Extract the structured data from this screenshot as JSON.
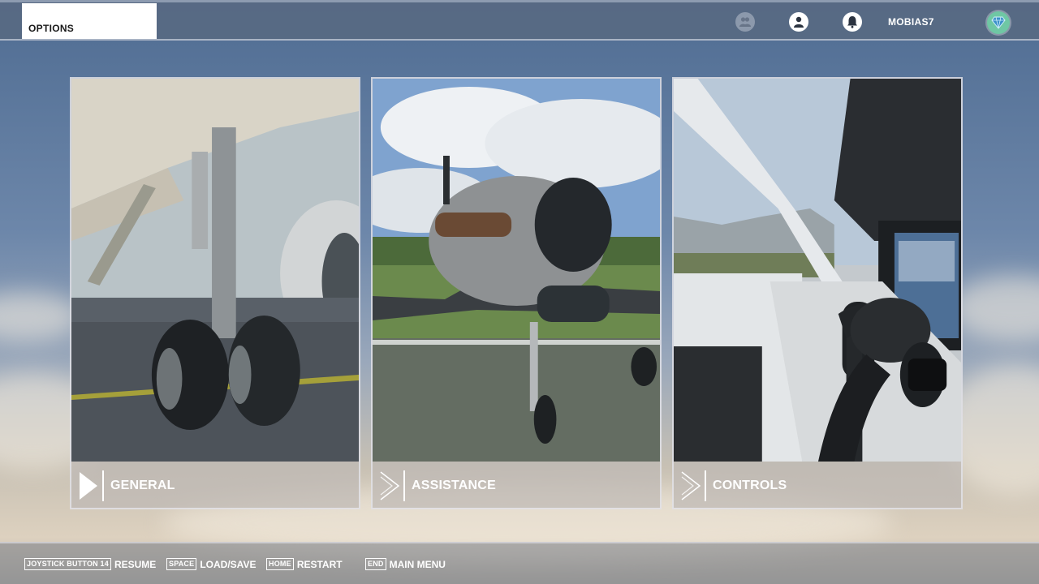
{
  "header": {
    "options_tab": "OPTIONS",
    "username": "MOBIAS7",
    "icons": [
      "friends-icon",
      "profile-icon",
      "notifications-icon",
      "gem-icon"
    ]
  },
  "cards": [
    {
      "label": "GENERAL",
      "selected": true,
      "image": "airliner-landing-gear"
    },
    {
      "label": "ASSISTANCE",
      "selected": false,
      "image": "propeller-plane-front"
    },
    {
      "label": "CONTROLS",
      "selected": false,
      "image": "cockpit-yoke"
    }
  ],
  "footer": {
    "hints": [
      {
        "key": "JOYSTICK BUTTON 14",
        "label": "RESUME"
      },
      {
        "key": "SPACE",
        "label": "LOAD/SAVE"
      },
      {
        "key": "HOME",
        "label": "RESTART"
      },
      {
        "key": "END",
        "label": "MAIN MENU"
      }
    ]
  },
  "colors": {
    "topbar": "#58698a",
    "accent_gem": "#6fc7a4"
  }
}
